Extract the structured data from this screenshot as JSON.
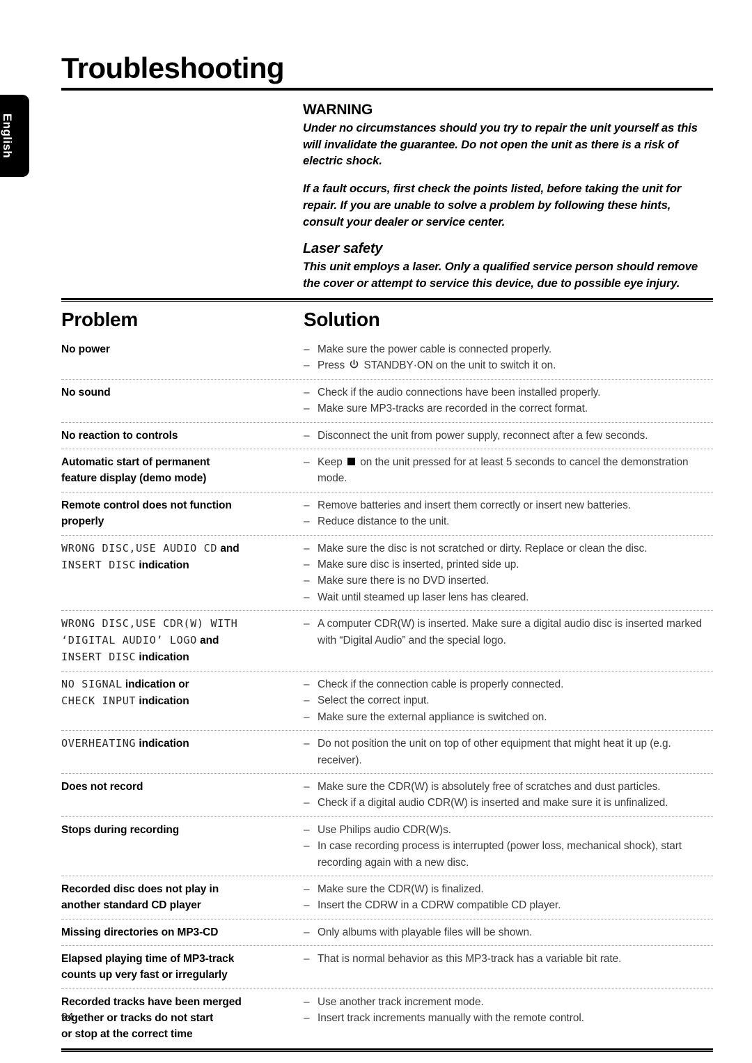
{
  "sidebar": {
    "language_tab": "English"
  },
  "header": {
    "title": "Troubleshooting"
  },
  "warning": {
    "heading": "WARNING",
    "paragraph_1": "Under no circumstances should you try to repair the unit yourself as this will invalidate the guarantee. Do not open the unit as there is a risk of electric shock.",
    "paragraph_2": "If a fault occurs, first check the points listed, before taking the unit for repair. If you are unable to solve a problem by following these hints, consult your dealer or service center.",
    "laser_heading": "Laser safety",
    "laser_paragraph": "This unit employs a laser. Only a qualified service person should remove the cover or attempt to service this device, due to possible eye injury."
  },
  "table": {
    "header_problem": "Problem",
    "header_solution": "Solution",
    "rows": [
      {
        "problem_lines": [
          {
            "text": "No power",
            "style": "bold"
          }
        ],
        "solutions": [
          {
            "text": "Make sure the power cable is connected properly."
          },
          {
            "text_before": "Press ",
            "icon": "power-standby-icon",
            "text_after": " STANDBY·ON on the unit to switch it on."
          }
        ]
      },
      {
        "problem_lines": [
          {
            "text": "No sound",
            "style": "bold"
          }
        ],
        "solutions": [
          {
            "text": "Check if the audio connections have been installed properly."
          },
          {
            "text": "Make sure MP3-tracks are recorded in the correct format."
          }
        ]
      },
      {
        "problem_lines": [
          {
            "text": "No reaction to controls",
            "style": "bold"
          }
        ],
        "solutions": [
          {
            "text": "Disconnect the unit from power supply, reconnect after a few seconds."
          }
        ]
      },
      {
        "problem_lines": [
          {
            "text": "Automatic start of permanent",
            "style": "bold"
          },
          {
            "text": "feature display (demo mode)",
            "style": "bold"
          }
        ],
        "solutions": [
          {
            "text_before": "Keep ",
            "icon": "stop-square-icon",
            "text_after": " on the unit pressed for at least 5 seconds to cancel the demonstration mode."
          }
        ]
      },
      {
        "problem_lines": [
          {
            "text": "Remote control does not function",
            "style": "bold"
          },
          {
            "text": "properly",
            "style": "bold"
          }
        ],
        "solutions": [
          {
            "text": "Remove batteries and insert them correctly or insert new batteries."
          },
          {
            "text": "Reduce distance to the unit."
          }
        ]
      },
      {
        "problem_lines": [
          {
            "lcd": "WRONG DISC,USE AUDIO CD",
            "bold_suffix": " and",
            "style": "lcd"
          },
          {
            "lcd": "INSERT DISC",
            "bold_suffix": " indication",
            "style": "lcd"
          }
        ],
        "solutions": [
          {
            "text": "Make sure the disc is not scratched or dirty. Replace or clean the disc."
          },
          {
            "text": "Make sure disc is inserted, printed side up."
          },
          {
            "text": "Make sure there is no DVD inserted."
          },
          {
            "text": "Wait until steamed up laser lens has cleared."
          }
        ]
      },
      {
        "problem_lines": [
          {
            "lcd": "WRONG DISC,USE CDR(W) WITH",
            "bold_suffix": "",
            "style": "lcd"
          },
          {
            "lcd": "‘DIGITAL AUDIO’ LOGO",
            "bold_suffix": " and",
            "style": "lcd"
          },
          {
            "lcd": "INSERT DISC",
            "bold_suffix": " indication",
            "style": "lcd"
          }
        ],
        "solutions": [
          {
            "text": "A computer CDR(W) is inserted. Make sure a digital audio disc is inserted marked with “Digital Audio” and the special logo."
          }
        ]
      },
      {
        "problem_lines": [
          {
            "lcd": "NO SIGNAL",
            "bold_suffix": " indication or",
            "style": "lcd"
          },
          {
            "lcd": "CHECK INPUT",
            "bold_suffix": " indication",
            "style": "lcd"
          }
        ],
        "solutions": [
          {
            "text": "Check if the connection cable is properly connected."
          },
          {
            "text": "Select the correct input."
          },
          {
            "text": "Make sure the external appliance is switched on."
          }
        ]
      },
      {
        "problem_lines": [
          {
            "lcd": "OVERHEATING",
            "bold_suffix": " indication",
            "style": "lcd"
          }
        ],
        "solutions": [
          {
            "text": "Do not position the unit on top of other equipment that might heat it up (e.g. receiver)."
          }
        ]
      },
      {
        "problem_lines": [
          {
            "text": "Does not record",
            "style": "bold"
          }
        ],
        "solutions": [
          {
            "text": "Make sure the CDR(W) is absolutely free of scratches and dust particles."
          },
          {
            "text": "Check if a digital audio CDR(W) is inserted and make sure it is unfinalized."
          }
        ]
      },
      {
        "problem_lines": [
          {
            "text": "Stops during recording",
            "style": "bold"
          }
        ],
        "solutions": [
          {
            "text": "Use Philips audio CDR(W)s."
          },
          {
            "text": "In case recording process is interrupted (power loss, mechanical shock), start recording again with a new disc."
          }
        ]
      },
      {
        "problem_lines": [
          {
            "text": "Recorded disc does not play in",
            "style": "bold"
          },
          {
            "text": "another standard CD player",
            "style": "bold"
          }
        ],
        "solutions": [
          {
            "text": "Make sure the CDR(W) is finalized."
          },
          {
            "text": "Insert the CDRW in a CDRW compatible CD player."
          }
        ]
      },
      {
        "problem_lines": [
          {
            "text": "Missing directories on MP3-CD",
            "style": "bold"
          }
        ],
        "solutions": [
          {
            "text": "Only albums with playable files will be shown."
          }
        ]
      },
      {
        "problem_lines": [
          {
            "text": "Elapsed playing time of MP3-track",
            "style": "bold"
          },
          {
            "text": "counts up very fast or irregularly",
            "style": "bold"
          }
        ],
        "solutions": [
          {
            "text": "That is normal behavior as this MP3-track has a variable bit rate."
          }
        ]
      },
      {
        "problem_lines": [
          {
            "text": "Recorded tracks have been merged",
            "style": "bold"
          },
          {
            "text": "together or tracks do not start",
            "style": "bold"
          },
          {
            "text": "or stop at the correct time",
            "style": "bold"
          }
        ],
        "solutions": [
          {
            "text": "Use another track increment mode."
          },
          {
            "text": "Insert track increments manually with the remote control."
          }
        ]
      }
    ]
  },
  "footer": {
    "page_number": "24"
  }
}
